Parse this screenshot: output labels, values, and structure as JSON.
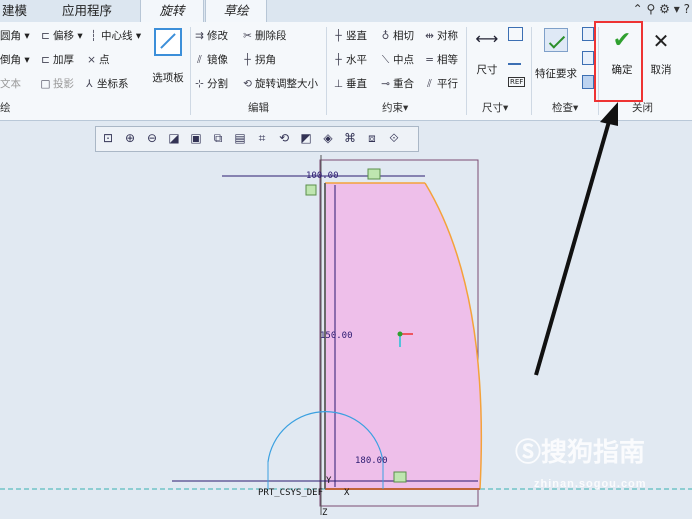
{
  "tabs": [
    {
      "label": "建模"
    },
    {
      "label": "应用程序"
    },
    {
      "label": "旋转"
    },
    {
      "label": "草绘"
    }
  ],
  "groups": {
    "sketch": {
      "label": "绘",
      "items": [
        "圆角",
        "偏移",
        "中心线",
        "倒角",
        "加厚",
        "点",
        "文本",
        "投影",
        "坐标系"
      ],
      "palette": "选项板"
    },
    "edit": {
      "label": "编辑",
      "items": [
        "修改",
        "删除段",
        "镜像",
        "拐角",
        "分割",
        "旋转调整大小"
      ]
    },
    "constrain": {
      "label": "约束▾",
      "items": [
        "竖直",
        "相切",
        "对称",
        "水平",
        "中点",
        "相等",
        "垂直",
        "重合",
        "平行"
      ]
    },
    "dimension": {
      "label": "尺寸▾",
      "big": "尺寸"
    },
    "inspect": {
      "label": "检查▾",
      "big": "特征要求"
    },
    "close": {
      "label": "关闭",
      "ok": "确定",
      "cancel": "取消"
    }
  },
  "canvas": {
    "dims": {
      "top": "100.00",
      "left": "150.00",
      "bottom": "180.00"
    },
    "csys_label": "PRT_CSYS_DEF",
    "axis_x": "X",
    "axis_y": "Y",
    "axis_z": "Z"
  },
  "watermark": {
    "brand": "搜狗指南",
    "url": "zhinan.sogou.com"
  },
  "colors": {
    "fill": "#eebfea",
    "accent": "#e33",
    "sketch": "#f4a23a",
    "dim": "#2a1a70",
    "arc": "#3aa0e0"
  }
}
